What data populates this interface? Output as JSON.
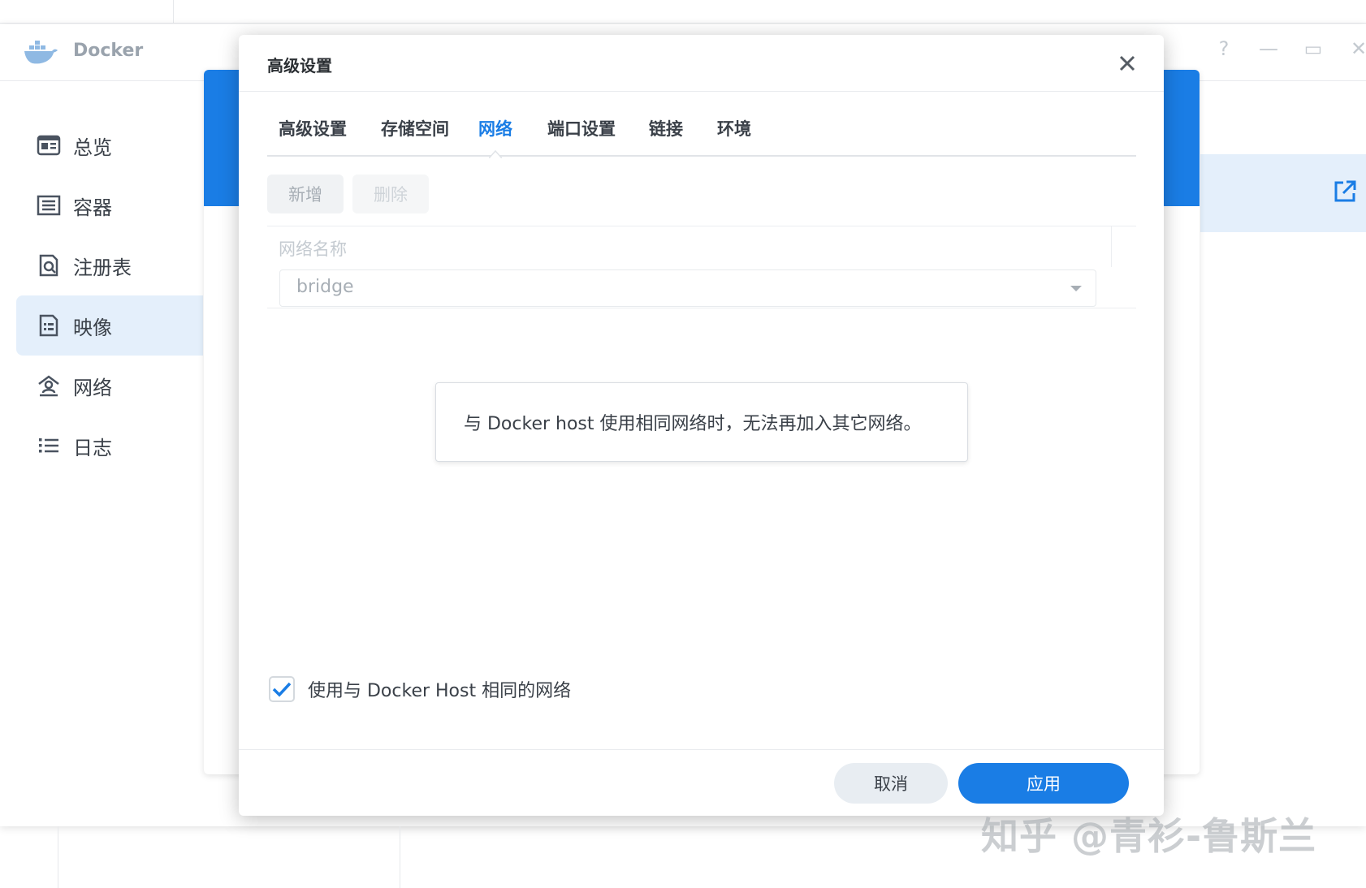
{
  "app": {
    "title": "Docker",
    "window_controls": {
      "help": "?",
      "minimize": "—",
      "maximize": "▭",
      "close": "✕"
    }
  },
  "sidebar": {
    "items": [
      {
        "label": "总览",
        "icon": "overview-icon",
        "active": false
      },
      {
        "label": "容器",
        "icon": "container-icon",
        "active": false
      },
      {
        "label": "注册表",
        "icon": "registry-icon",
        "active": false
      },
      {
        "label": "映像",
        "icon": "image-icon",
        "active": true
      },
      {
        "label": "网络",
        "icon": "network-icon",
        "active": false
      },
      {
        "label": "日志",
        "icon": "log-icon",
        "active": false
      }
    ]
  },
  "dialog": {
    "title": "高级设置",
    "tabs": [
      {
        "label": "高级设置",
        "active": false
      },
      {
        "label": "存储空间",
        "active": false
      },
      {
        "label": "网络",
        "active": true
      },
      {
        "label": "端口设置",
        "active": false
      },
      {
        "label": "链接",
        "active": false
      },
      {
        "label": "环境",
        "active": false
      }
    ],
    "toolbar": {
      "add_label": "新增",
      "delete_label": "删除"
    },
    "table": {
      "column_network_name": "网络名称",
      "select_value": "bridge"
    },
    "tooltip": "与 Docker host 使用相同网络时，无法再加入其它网络。",
    "checkbox": {
      "label": "使用与 Docker Host 相同的网络",
      "checked": true
    },
    "footer": {
      "cancel_label": "取消",
      "apply_label": "应用"
    }
  },
  "watermark": "知乎 @青衫-鲁斯兰",
  "colors": {
    "accent": "#1a7de5",
    "active_bg": "#e4effb",
    "text": "#3a4048"
  }
}
